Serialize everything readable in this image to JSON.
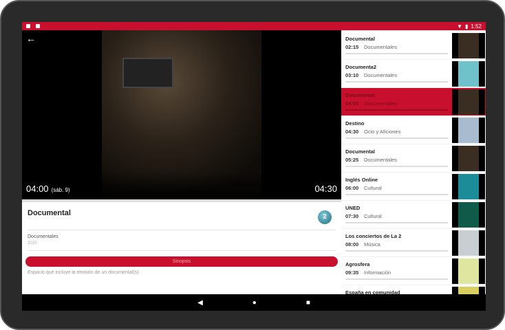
{
  "status": {
    "time": "1:52"
  },
  "player": {
    "start_time": "04:00",
    "day": "(sáb. 9)",
    "end_time": "04:30"
  },
  "program": {
    "title": "Documental",
    "channel_logo": "2",
    "genre": "Documentales",
    "year": "2015",
    "sinopsis_label": "Sinopsis",
    "synopsis": "Espacio que incluye la emisión de un documental(s)."
  },
  "schedule": [
    {
      "title": "Documental",
      "time": "02:15",
      "genre": "Documentales",
      "thumb": "#3a2d22"
    },
    {
      "title": "Documenta2",
      "time": "03:10",
      "genre": "Documentales",
      "thumb": "#6fc2c9"
    },
    {
      "title": "Documental",
      "time": "04:00",
      "genre": "Documentales",
      "thumb": "#3a2d22",
      "selected": true
    },
    {
      "title": "Destino",
      "time": "04:30",
      "genre": "Ocio y Aficiones",
      "thumb": "#a9bccf"
    },
    {
      "title": "Documental",
      "time": "05:25",
      "genre": "Documentales",
      "thumb": "#3a2d22"
    },
    {
      "title": "Inglés Online",
      "time": "06:00",
      "genre": "Cultural",
      "thumb": "#1b8c98"
    },
    {
      "title": "UNED",
      "time": "07:30",
      "genre": "Cultural",
      "thumb": "#0f5a48"
    },
    {
      "title": "Los conciertos de La 2",
      "time": "08:00",
      "genre": "Música",
      "thumb": "#c9ced2"
    },
    {
      "title": "Agrosfera",
      "time": "09:35",
      "genre": "Información",
      "thumb": "#dfe6a0"
    },
    {
      "title": "España en comunidad",
      "time": "",
      "genre": "",
      "thumb": "#d8cf60"
    }
  ],
  "colors": {
    "accent": "#c8102e"
  }
}
